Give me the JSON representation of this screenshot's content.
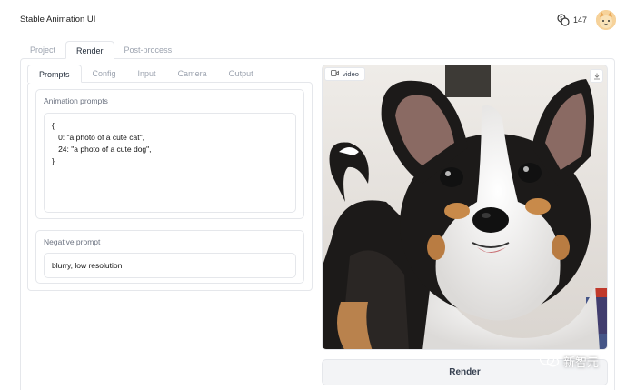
{
  "header": {
    "app_title": "Stable Animation UI",
    "credits": "147"
  },
  "outer_tabs": [
    {
      "label": "Project"
    },
    {
      "label": "Render"
    },
    {
      "label": "Post-process"
    }
  ],
  "inner_tabs": [
    {
      "label": "Prompts"
    },
    {
      "label": "Config"
    },
    {
      "label": "Input"
    },
    {
      "label": "Camera"
    },
    {
      "label": "Output"
    }
  ],
  "animation_prompts": {
    "label": "Animation prompts",
    "value": "{\n   0: \"a photo of a cute cat\",\n   24: \"a photo of a cute dog\",\n}"
  },
  "negative_prompt": {
    "label": "Negative prompt",
    "value": "blurry, low resolution"
  },
  "video": {
    "label": "video"
  },
  "render_button": "Render",
  "watermark": "新智元"
}
